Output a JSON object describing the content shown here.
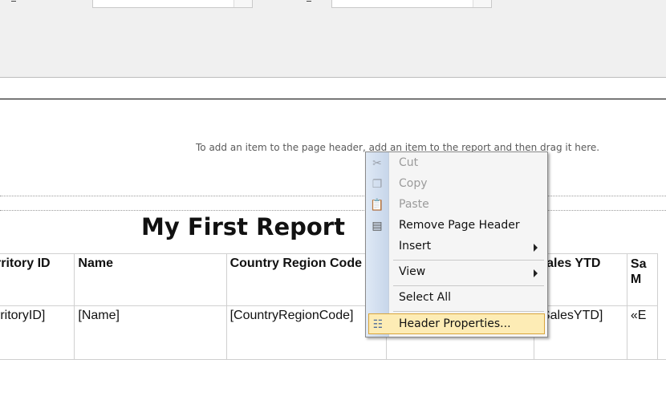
{
  "page_header": {
    "hint": "To add an item to the page header, add an item to the report and then drag it here."
  },
  "report": {
    "title": "My First Report",
    "columns": [
      "rritory ID",
      "Name",
      "Country Region Code",
      "",
      "Sales YTD",
      "Sa M"
    ],
    "column_cells": {
      "c1": "rritory ID",
      "c2": "Name",
      "c3": "Country Region Code",
      "c4": "",
      "c5": "Sales YTD",
      "c6a": "Sa",
      "c6b": "M"
    },
    "row": {
      "c1": "rritoryID]",
      "c2": "[Name]",
      "c3": "[CountryRegionCode]",
      "c4": "",
      "c5": "[SalesYTD]",
      "c6": "«E"
    }
  },
  "context_menu": {
    "items": [
      {
        "label": "Cut",
        "enabled": false,
        "icon": "scissors-icon"
      },
      {
        "label": "Copy",
        "enabled": false,
        "icon": "copy-icon"
      },
      {
        "label": "Paste",
        "enabled": false,
        "icon": "paste-icon"
      },
      {
        "label": "Remove Page Header",
        "enabled": true,
        "icon": "page-header-icon"
      },
      {
        "label": "Insert",
        "enabled": true,
        "submenu": true
      },
      {
        "label": "View",
        "enabled": true,
        "submenu": true
      },
      {
        "label": "Select All",
        "enabled": true
      },
      {
        "label": "Header Properties...",
        "enabled": true,
        "highlighted": true,
        "icon": "properties-icon"
      }
    ]
  },
  "colors": {
    "menu_highlight": "#fdecb5",
    "menu_highlight_border": "#d9a53b",
    "panel_background": "#f0f0f0"
  }
}
